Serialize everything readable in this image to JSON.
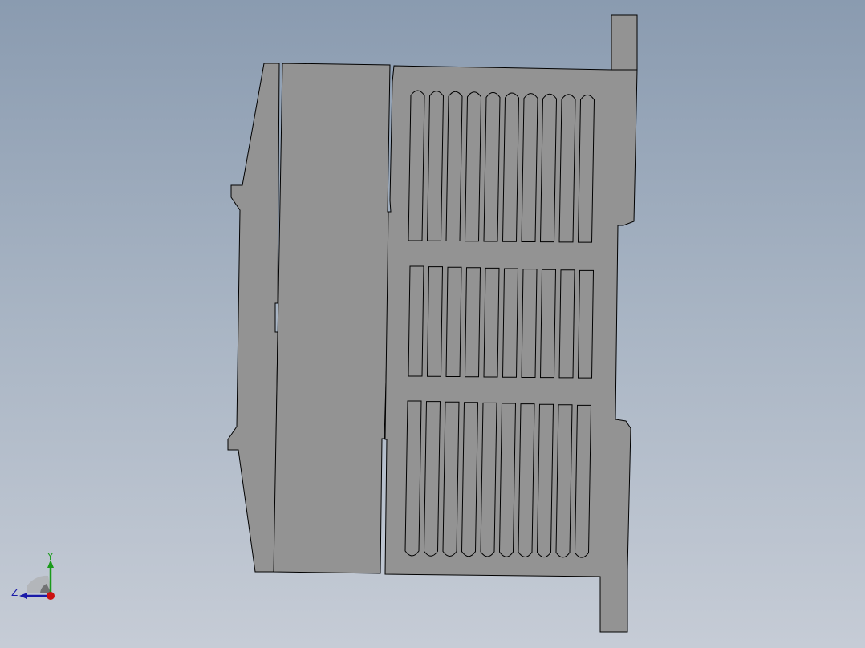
{
  "viewport": {
    "background_top": "#8a9bb0",
    "background_bottom": "#c6ccd6"
  },
  "model": {
    "fill_color": "#939393",
    "edge_color": "#000000",
    "slot_rows": 3,
    "slots_per_row": 10
  },
  "triad": {
    "y_label": "Y",
    "z_label": "Z",
    "y_color": "#1a9a1a",
    "z_color": "#1a1aa8",
    "x_color": "#cc1111"
  }
}
